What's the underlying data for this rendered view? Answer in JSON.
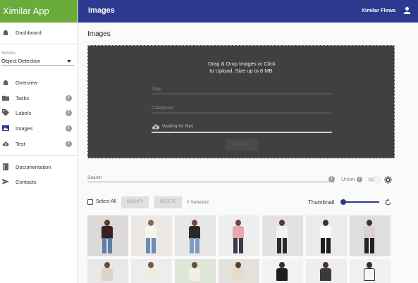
{
  "app": {
    "name": "Ximilar App"
  },
  "header": {
    "title": "Images",
    "flows_label": "Ximilar Flows"
  },
  "sidebar": {
    "dashboard": "Dashboard",
    "service_label": "Service",
    "service_value": "Object Detection",
    "items": [
      {
        "label": "Overview"
      },
      {
        "label": "Tasks"
      },
      {
        "label": "Labels"
      },
      {
        "label": "Images"
      },
      {
        "label": "Test"
      }
    ],
    "documentation": "Documentation",
    "contacts": "Contacts"
  },
  "main": {
    "page_title": "Images",
    "dropzone": {
      "headline_line1": "Drag & Drop Images or Click",
      "headline_line2": "to Upload. Size up to 8 MB.",
      "tags_placeholder": "Tags",
      "categories_placeholder": "Categories",
      "upload_status": "Waiting for files",
      "load_button": "LOAD (0)"
    },
    "search_placeholder": "Search",
    "union_label": "Union",
    "select_all_label": "Select All",
    "modify_button": "MODIFY",
    "delete_button": "DELETE",
    "selected_count": "0 Selected",
    "thumbnail_label": "Thumbnail"
  },
  "colors": {
    "brand_green": "#6aab3c",
    "header_blue": "#2b3a8f",
    "dropzone_bg": "#404040"
  },
  "icons": [
    "home-icon",
    "folder-icon",
    "tag-icon",
    "image-icon",
    "cloud-upload-icon",
    "book-icon",
    "send-icon",
    "user-icon",
    "info-icon",
    "gear-icon",
    "refresh-icon",
    "chevron-down-icon"
  ]
}
